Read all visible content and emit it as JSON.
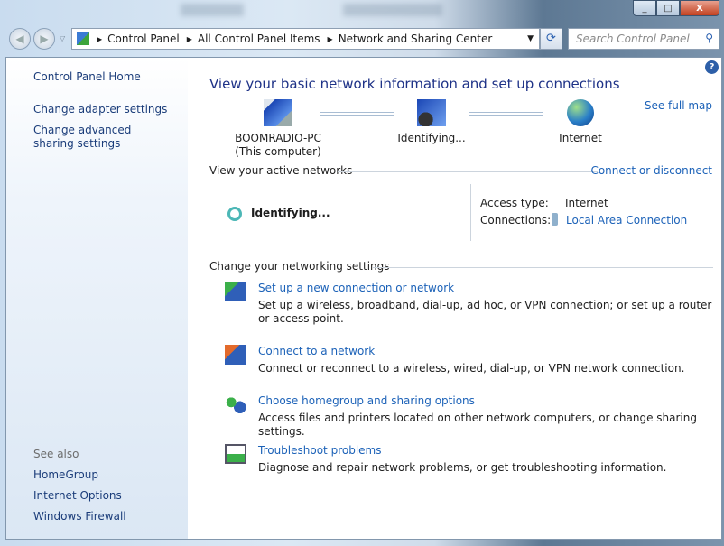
{
  "window": {
    "minimize": "_",
    "maximize": "□",
    "close": "X"
  },
  "address": {
    "crumbs": [
      "Control Panel",
      "All Control Panel Items",
      "Network and Sharing Center"
    ],
    "search_placeholder": "Search Control Panel"
  },
  "sidebar": {
    "home": "Control Panel Home",
    "links": [
      "Change adapter settings",
      "Change advanced sharing settings"
    ],
    "see_also": "See also",
    "see_also_links": [
      "HomeGroup",
      "Internet Options",
      "Windows Firewall"
    ]
  },
  "main": {
    "title": "View your basic network information and set up connections",
    "see_full_map": "See full map",
    "map": {
      "computer": "BOOMRADIO-PC",
      "computer_sub": "(This computer)",
      "network": "Identifying...",
      "internet": "Internet"
    },
    "active_header": "View your active networks",
    "connect_disconnect": "Connect or disconnect",
    "active": {
      "name": "Identifying...",
      "access_label": "Access type:",
      "access_value": "Internet",
      "conn_label": "Connections:",
      "conn_value": "Local Area Connection"
    },
    "settings_header": "Change your networking settings",
    "tasks": [
      {
        "title": "Set up a new connection or network",
        "desc": "Set up a wireless, broadband, dial-up, ad hoc, or VPN connection; or set up a router or access point."
      },
      {
        "title": "Connect to a network",
        "desc": "Connect or reconnect to a wireless, wired, dial-up, or VPN network connection."
      },
      {
        "title": "Choose homegroup and sharing options",
        "desc": "Access files and printers located on other network computers, or change sharing settings."
      },
      {
        "title": "Troubleshoot problems",
        "desc": "Diagnose and repair network problems, or get troubleshooting information."
      }
    ]
  }
}
